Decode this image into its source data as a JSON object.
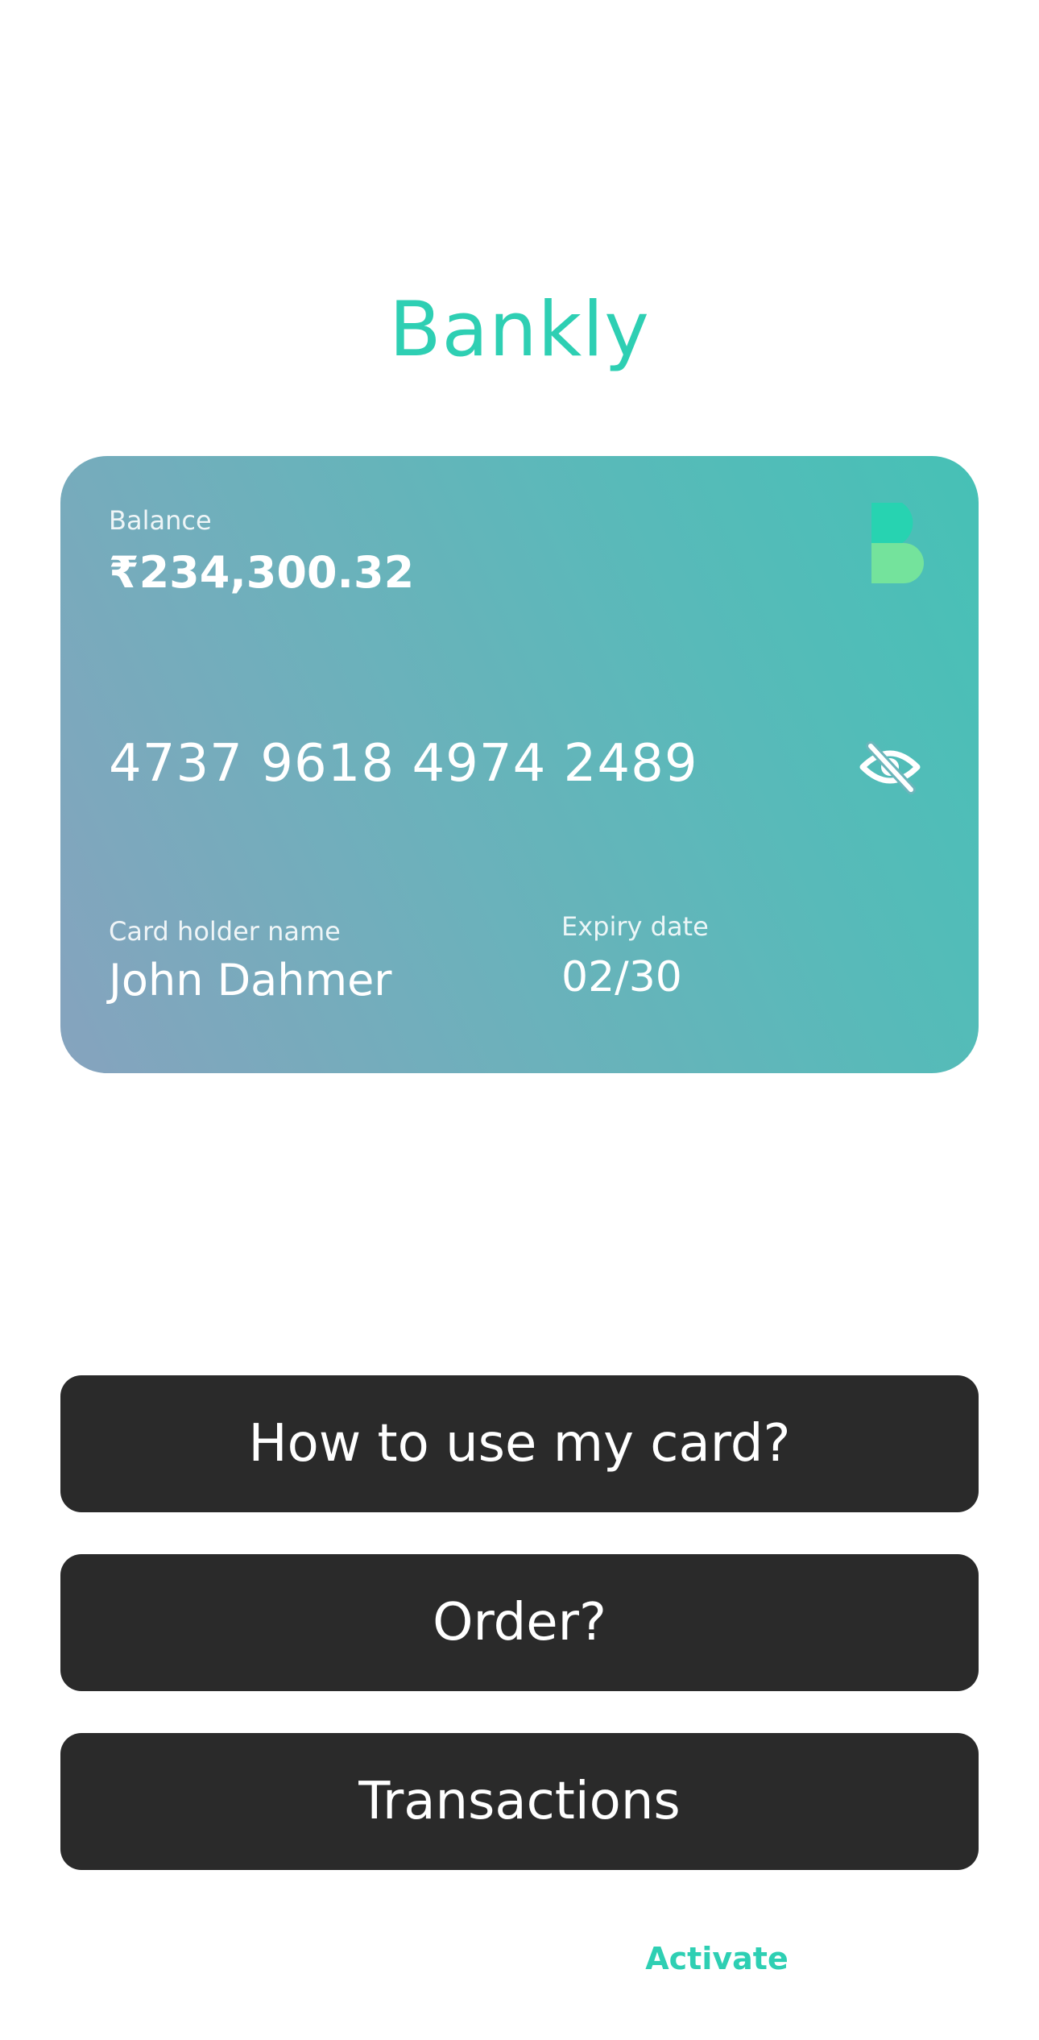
{
  "app": {
    "title": "Bankly"
  },
  "card": {
    "balance_label": "Balance",
    "balance_value": "₹234,300.32",
    "number": "4737 9618 4974 2489",
    "holder_label": "Card holder name",
    "holder_name": "John Dahmer",
    "expiry_label": "Expiry date",
    "expiry_value": "02/30",
    "logo_icon": "bankly-b-logo-icon",
    "visibility_icon": "eye-off-icon"
  },
  "actions": {
    "how_to_use": "How to use my card?",
    "order": "Order?",
    "transactions": "Transactions",
    "activate": "Activate"
  },
  "colors": {
    "brand": "#2ecfb3",
    "button_bg": "#2a2a2a",
    "card_gradient_start": "#86a3be",
    "card_gradient_end": "#46c1b6",
    "logo_top": "#27d3b1",
    "logo_bottom": "#74e39c"
  }
}
